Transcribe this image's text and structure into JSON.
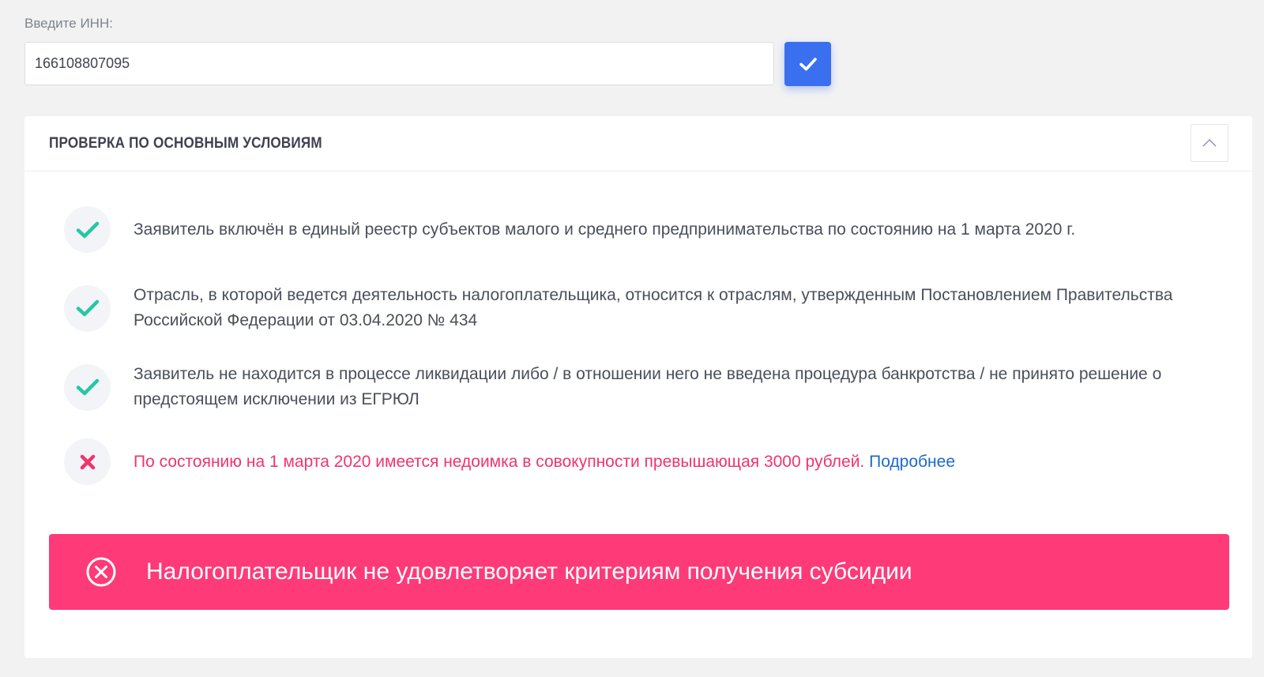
{
  "inn": {
    "label": "Введите ИНН:",
    "value": "166108807095"
  },
  "check_card": {
    "title": "ПРОВЕРКА ПО ОСНОВНЫМ УСЛОВИЯМ",
    "conditions": [
      {
        "status": "ok",
        "icon": "check-icon",
        "text": "Заявитель включён в единый реестр субъектов малого и среднего предпринимательства по состоянию на 1 марта 2020 г."
      },
      {
        "status": "ok",
        "icon": "check-icon",
        "text": "Отрасль, в которой ведется деятельность налогоплательщика, относится к отраслям, утвержденным Постановлением Правительства Российской Федерации от 03.04.2020 № 434"
      },
      {
        "status": "ok",
        "icon": "check-icon",
        "text": "Заявитель не находится в процессе ликвидации либо / в отношении него не введена процедура банкротства / не принято решение о предстоящем исключении из ЕГРЮЛ"
      },
      {
        "status": "fail",
        "icon": "cross-icon",
        "text": "По состоянию на 1 марта 2020 имеется недоимка в совокупности превышающая 3000 рублей.",
        "link": "Подробнее"
      }
    ],
    "result": "Налогоплательщик не удовлетворяет критериям получения субсидии"
  },
  "colors": {
    "accent_blue": "#3a6ff0",
    "ok_green": "#26c6a6",
    "fail_pink": "#f0346e",
    "banner_pink": "#fe3a78",
    "link_blue": "#1c6bc9"
  }
}
